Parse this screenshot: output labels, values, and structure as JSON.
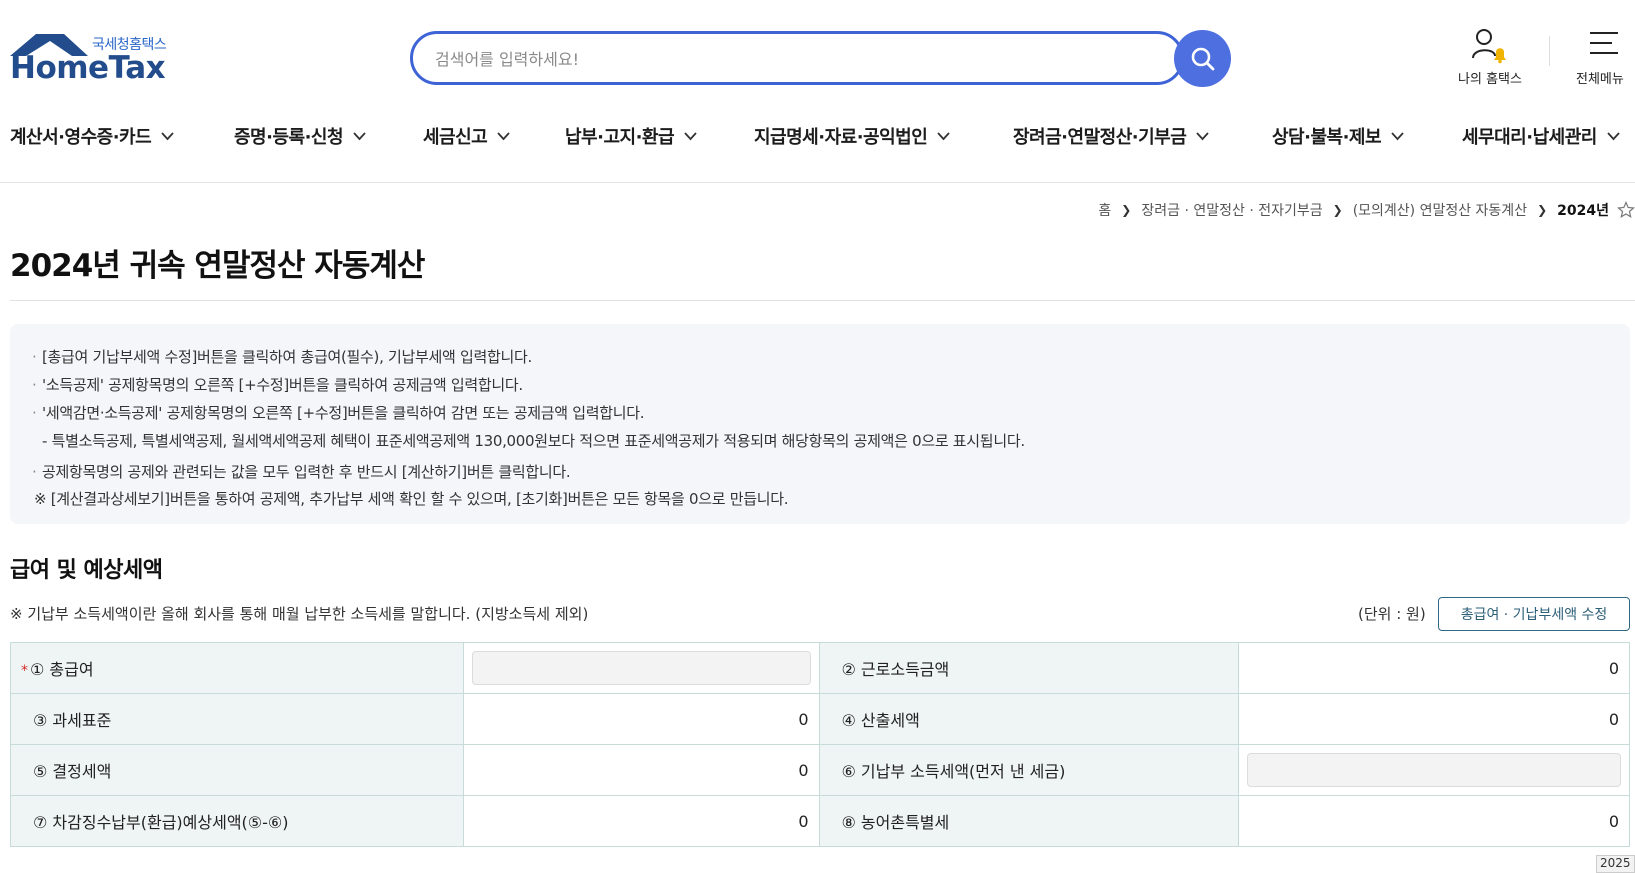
{
  "header": {
    "logo_sub": "국세청홈택스",
    "logo_main": "HomeTax",
    "search_placeholder": "검색어를 입력하세요!",
    "my_hometax": "나의 홈택스",
    "all_menu": "전체메뉴",
    "colors": {
      "brand": "#234c8c",
      "search_accent": "#4d6fe0",
      "bell": "#f0b400"
    }
  },
  "gnb": [
    "계산서·영수증·카드",
    "증명·등록·신청",
    "세금신고",
    "납부·고지·환급",
    "지급명세·자료·공익법인",
    "장려금·연말정산·기부금",
    "상담·불복·제보",
    "세무대리·납세관리"
  ],
  "breadcrumb": {
    "home": "홈",
    "level1": "장려금 · 연말정산 · 전자기부금",
    "level2": "(모의계산) 연말정산 자동계산",
    "current": "2024년"
  },
  "page_title": "2024년 귀속 연말정산 자동계산",
  "info": {
    "line1": "[총급여 기납부세액 수정]버튼을 클릭하여 총급여(필수), 기납부세액 입력합니다.",
    "line2": "'소득공제' 공제항목명의 오른쪽 [+수정]버튼을 클릭하여 공제금액 입력합니다.",
    "line3": "'세액감면·소득공제' 공제항목명의 오른쪽 [+수정]버튼을 클릭하여 감면 또는 공제금액 입력합니다.",
    "line4": "- 특별소득공제, 특별세액공제, 월세액세액공제 혜택이 표준세액공제액 130,000원보다 적으면 표준세액공제가 적용되며 해당항목의 공제액은 0으로 표시됩니다.",
    "line5": "공제항목명의 공제와 관련되는 값을 모두 입력한 후 반드시 [계산하기]버튼 클릭합니다.",
    "line6": "※ [계산결과상세보기]버튼을 통하여 공제액, 추가납부 세액 확인 할 수 있으며, [초기화]버튼은 모든 항목을 0으로 만듭니다."
  },
  "section": {
    "title": "급여 및 예상세액",
    "note": "※ 기납부 소득세액이란 올해 회사를 통해 매월 납부한 소득세를 말합니다. (지방소득세 제외)",
    "unit": "(단위 : 원)",
    "edit_button": "총급여 · 기납부세액 수정"
  },
  "table": {
    "required_mark": "*",
    "r1": {
      "l1": "① 총급여",
      "l2": "② 근로소득금액",
      "v2": "0"
    },
    "r2": {
      "l1": "③ 과세표준",
      "v1": "0",
      "l2": "④ 산출세액",
      "v2": "0"
    },
    "r3": {
      "l1": "⑤ 결정세액",
      "v1": "0",
      "l2": "⑥ 기납부 소득세액(먼저 낸 세금)"
    },
    "r4": {
      "l1": "⑦ 차감징수납부(환급)예상세액(⑤-⑥)",
      "v1": "0",
      "l2": "⑧ 농어촌특별세",
      "v2": "0"
    }
  },
  "corner_tip": "2025"
}
